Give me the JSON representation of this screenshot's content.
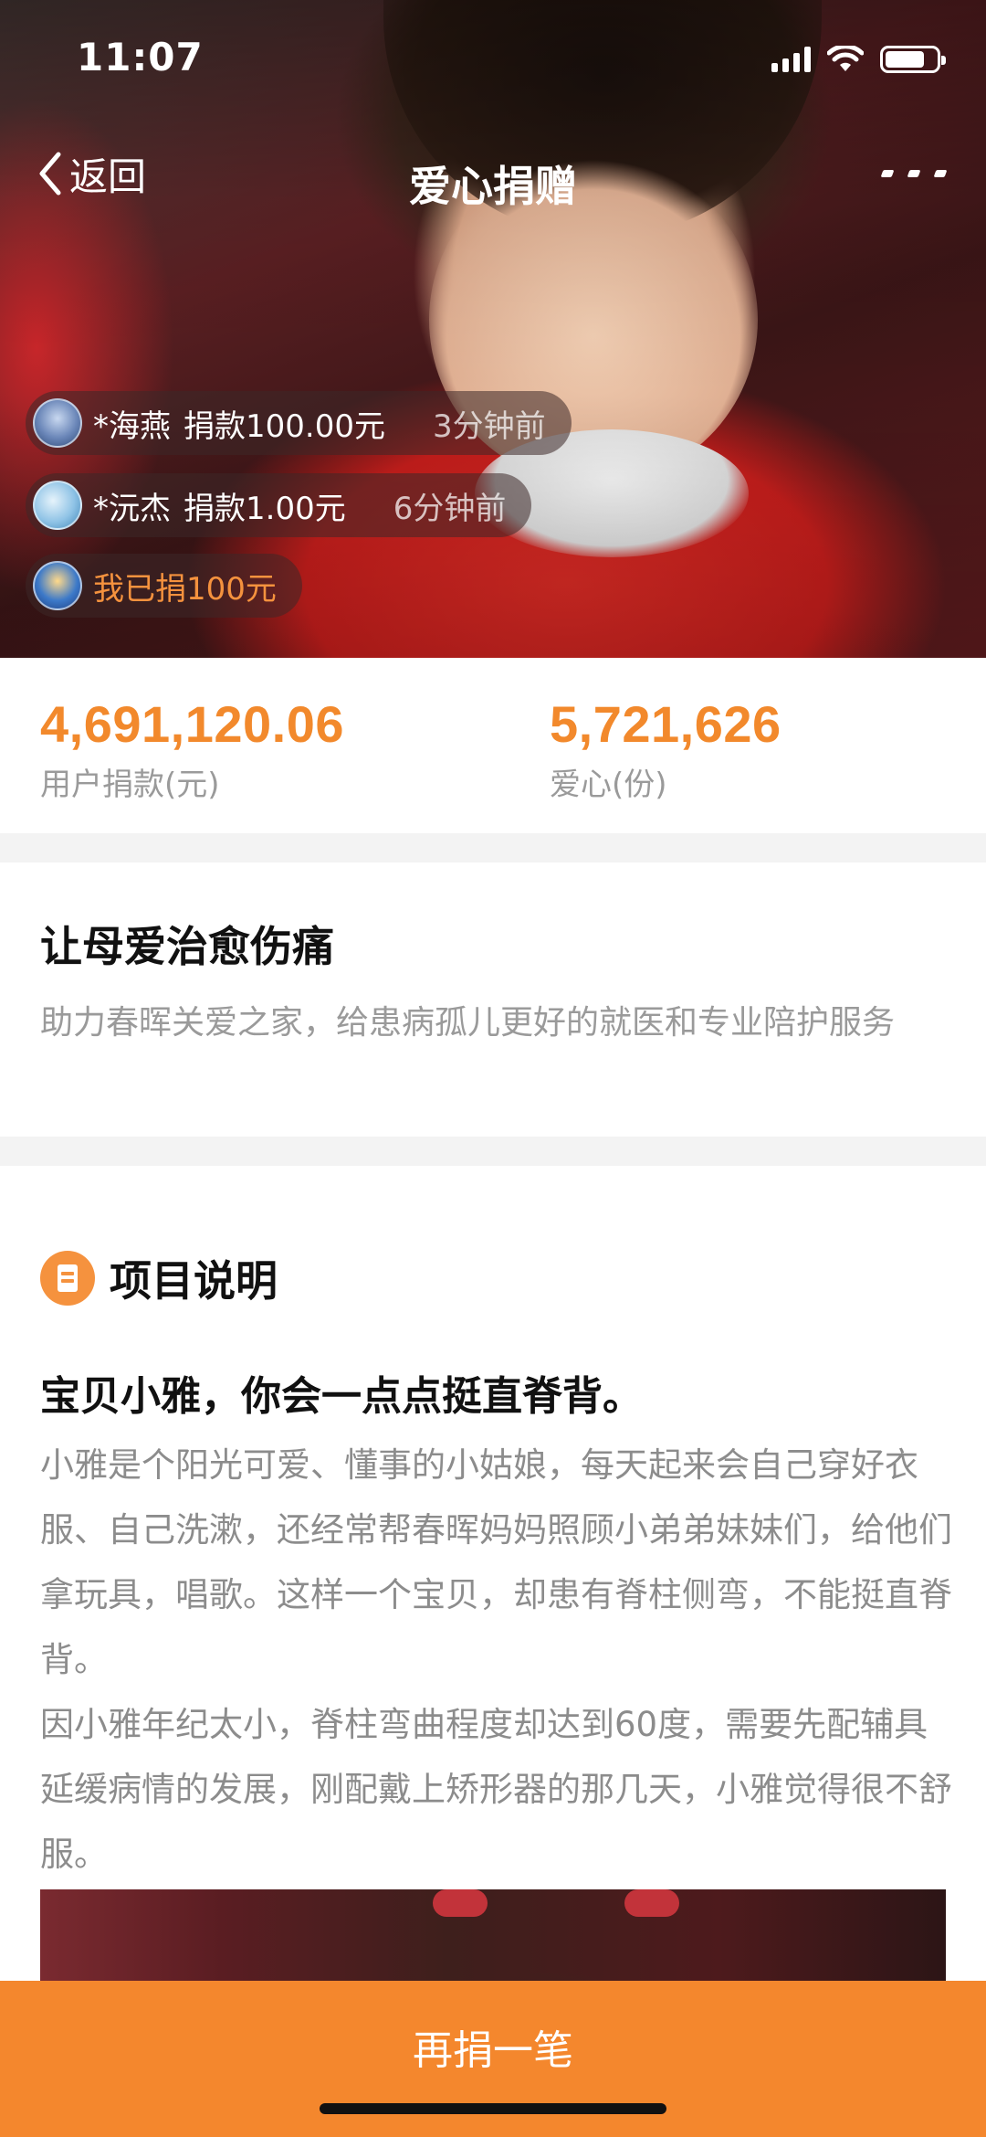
{
  "status_bar": {
    "time": "11:07"
  },
  "nav": {
    "back_label": "返回",
    "title": "爱心捐赠"
  },
  "donations": [
    {
      "name": "*海燕",
      "action": "捐款100.00元",
      "time": "3分钟前"
    },
    {
      "name": "*沅杰",
      "action": "捐款1.00元",
      "time": "6分钟前"
    }
  ],
  "my_donation": "我已捐100元",
  "stats": {
    "amount_value": "4,691,120.06",
    "amount_label": "用户捐款(元)",
    "hearts_value": "5,721,626",
    "hearts_label": "爱心(份)"
  },
  "project": {
    "title": "让母爱治愈伤痛",
    "subtitle": "助力春晖关爱之家，给患病孤儿更好的就医和专业陪护服务"
  },
  "section": {
    "label": "项目说明"
  },
  "story": {
    "heading": "宝贝小雅，你会一点点挺直脊背。",
    "paragraph1": "小雅是个阳光可爱、懂事的小姑娘，每天起来会自己穿好衣服、自己洗漱，还经常帮春晖妈妈照顾小弟弟妹妹们，给他们拿玩具，唱歌。这样一个宝贝，却患有脊柱侧弯，不能挺直脊背。",
    "paragraph2": "因小雅年纪太小，脊柱弯曲程度却达到60度，需要先配辅具延缓病情的发展，刚配戴上矫形器的那几天，小雅觉得很不舒服。"
  },
  "cta": {
    "label": "再捐一笔"
  },
  "colors": {
    "accent": "#f4872d",
    "stat_orange": "#f2892c",
    "muted_text": "#9a9a9a"
  }
}
